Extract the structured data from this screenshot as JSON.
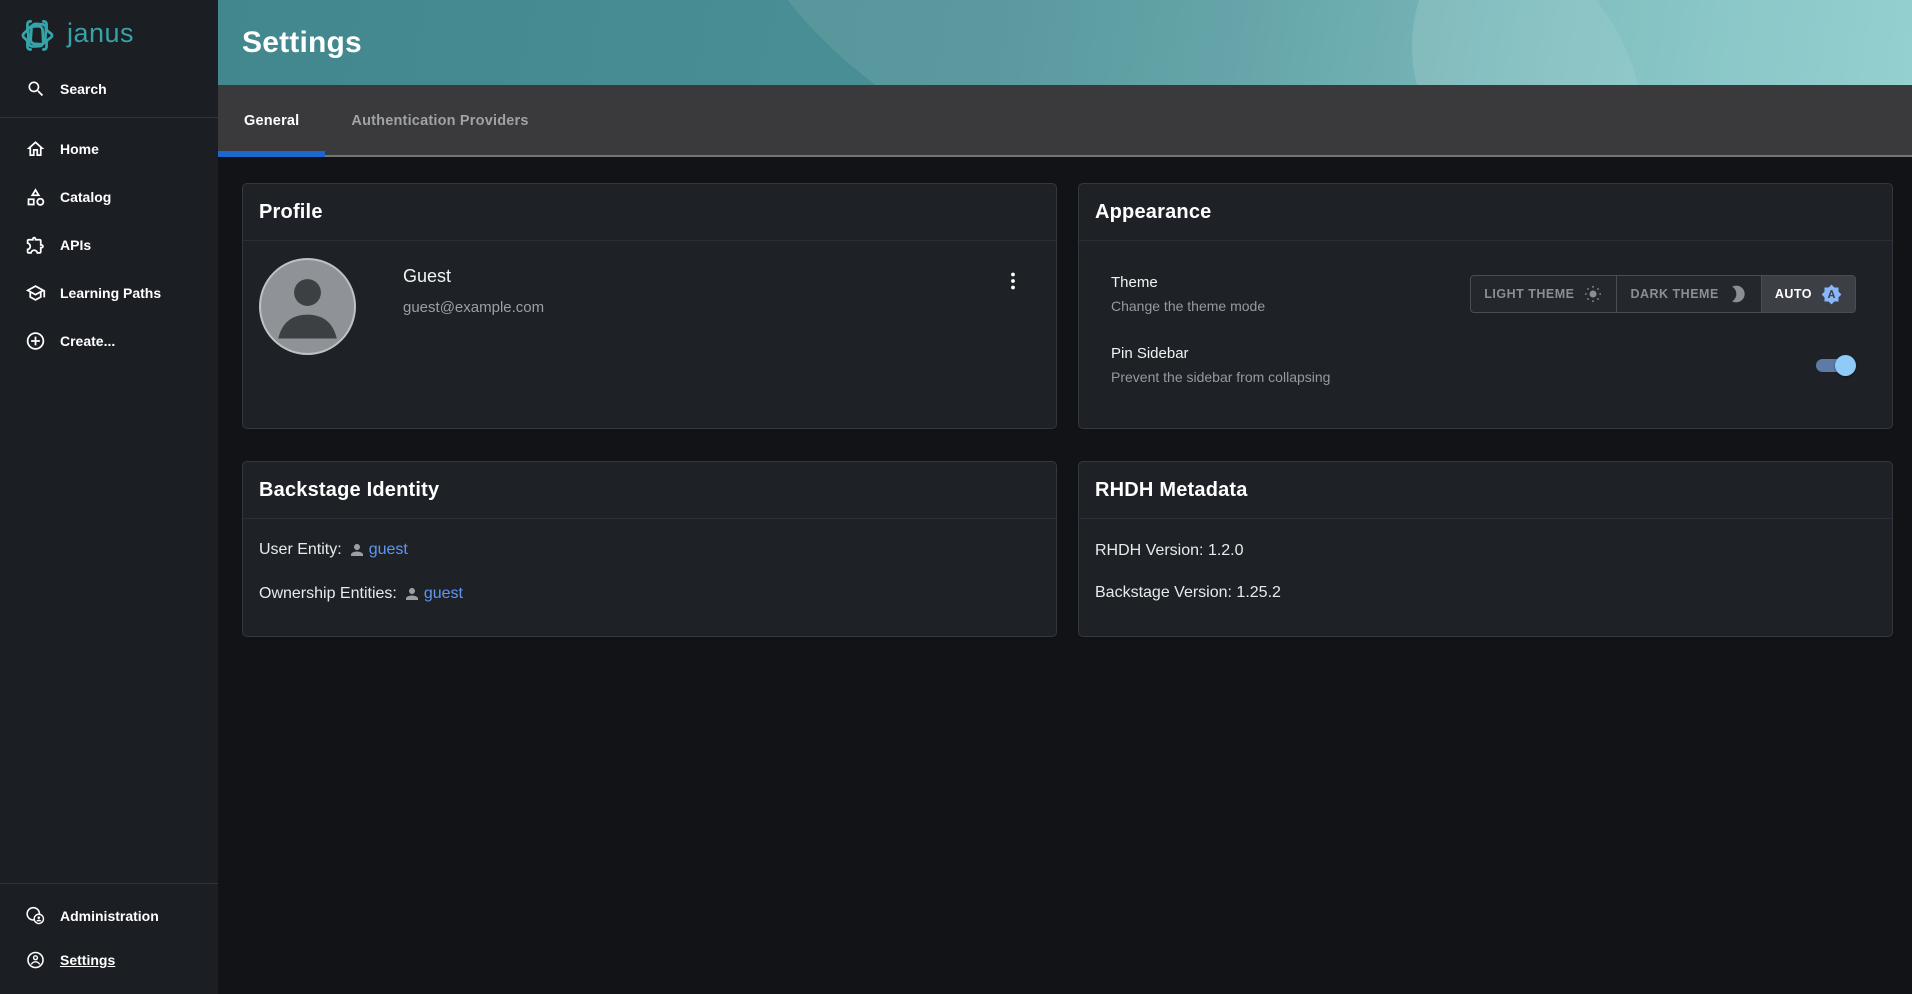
{
  "brand": {
    "name": "janus"
  },
  "sidebar": {
    "search_label": "Search",
    "items": [
      {
        "label": "Home",
        "icon": "home-icon"
      },
      {
        "label": "Catalog",
        "icon": "catalog-icon"
      },
      {
        "label": "APIs",
        "icon": "extension-icon"
      },
      {
        "label": "Learning Paths",
        "icon": "school-icon"
      },
      {
        "label": "Create...",
        "icon": "add-circle-icon"
      }
    ],
    "bottom_items": [
      {
        "label": "Administration",
        "icon": "administration-icon"
      },
      {
        "label": "Settings",
        "icon": "account-circle-icon",
        "active": true
      }
    ]
  },
  "header": {
    "title": "Settings"
  },
  "tabs": [
    {
      "label": "General",
      "active": true
    },
    {
      "label": "Authentication Providers",
      "active": false
    }
  ],
  "profile_card": {
    "title": "Profile",
    "name": "Guest",
    "email": "guest@example.com",
    "menu_icon": "more-vert-icon"
  },
  "appearance_card": {
    "title": "Appearance",
    "theme": {
      "label": "Theme",
      "description": "Change the theme mode",
      "options": [
        {
          "label": "LIGHT THEME",
          "icon": "sun-icon",
          "selected": false
        },
        {
          "label": "DARK THEME",
          "icon": "moon-icon",
          "selected": false
        },
        {
          "label": "AUTO",
          "icon": "brightness-auto-icon",
          "selected": true
        }
      ]
    },
    "pin_sidebar": {
      "label": "Pin Sidebar",
      "description": "Prevent the sidebar from collapsing",
      "enabled": true
    }
  },
  "identity_card": {
    "title": "Backstage Identity",
    "user_entity_label": "User Entity:",
    "user_entity_value": "guest",
    "ownership_entities_label": "Ownership Entities:",
    "ownership_entities_value": "guest"
  },
  "metadata_card": {
    "title": "RHDH Metadata",
    "rhdh_version_label": "RHDH Version:",
    "rhdh_version_value": "1.2.0",
    "backstage_version_label": "Backstage Version:",
    "backstage_version_value": "1.25.2"
  },
  "colors": {
    "brand_teal": "#35a4a9",
    "header_teal_start": "#41878d",
    "header_teal_end": "#85c9c9",
    "tab_indicator_blue": "#1c66cf",
    "link_blue": "#5f97f3",
    "switch_thumb_blue": "#90caf9",
    "auto_icon_blue": "#8ab6f9"
  }
}
